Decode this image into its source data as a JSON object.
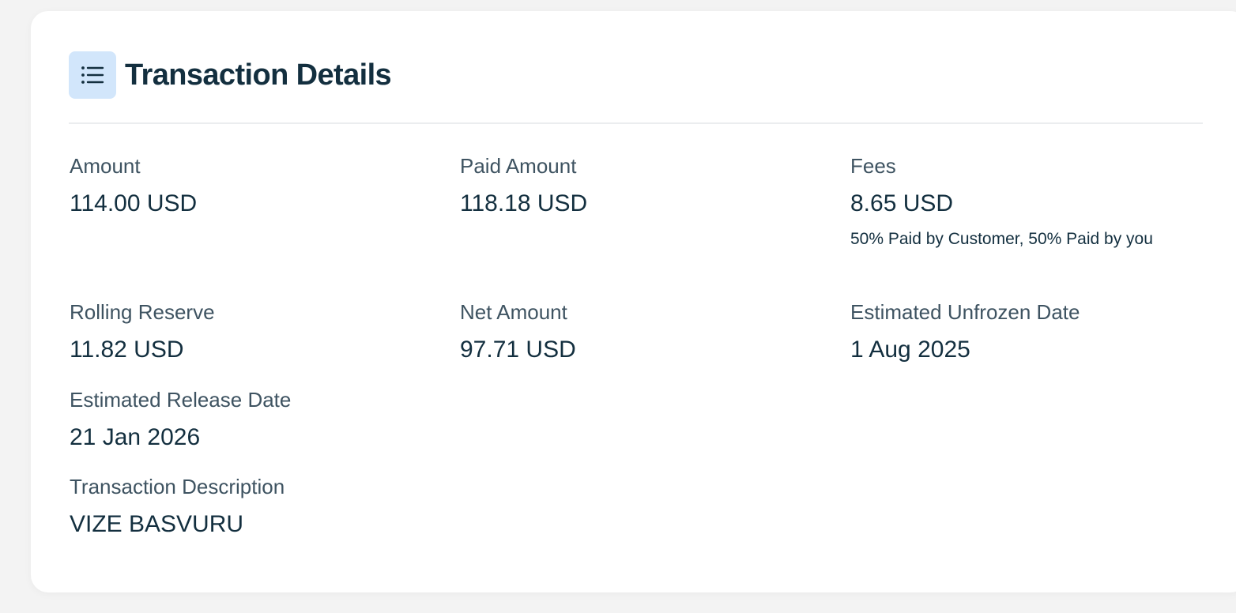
{
  "card": {
    "title": "Transaction Details",
    "icon": "list-icon"
  },
  "fields": {
    "amount": {
      "label": "Amount",
      "value": "114.00 USD"
    },
    "paid_amount": {
      "label": "Paid Amount",
      "value": "118.18 USD"
    },
    "fees": {
      "label": "Fees",
      "value": "8.65 USD",
      "note": "50% Paid by Customer, 50% Paid by you"
    },
    "rolling_reserve": {
      "label": "Rolling Reserve",
      "value": "11.82 USD"
    },
    "net_amount": {
      "label": "Net Amount",
      "value": "97.71 USD"
    },
    "estimated_unfrozen_date": {
      "label": "Estimated Unfrozen Date",
      "value": "1 Aug 2025"
    },
    "estimated_release_date": {
      "label": "Estimated Release Date",
      "value": "21 Jan 2026"
    },
    "transaction_description": {
      "label": "Transaction Description",
      "value": "VIZE BASVURU"
    }
  },
  "colors": {
    "icon_background": "#d2e6fb",
    "text_primary": "#132f3f",
    "text_label": "#3e5361"
  }
}
